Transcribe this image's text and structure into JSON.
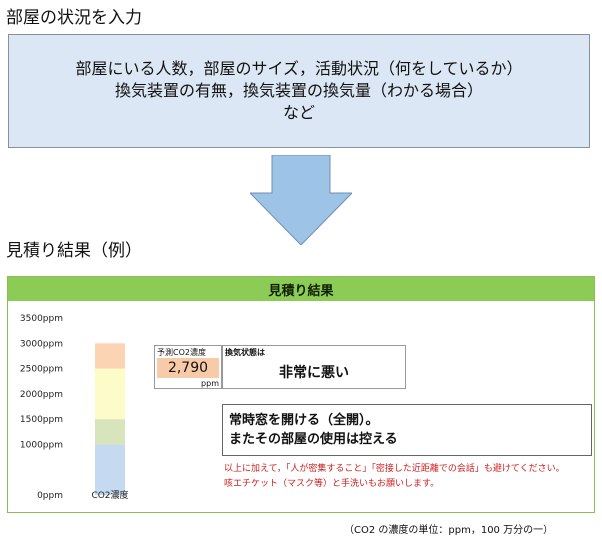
{
  "input_section": {
    "heading": "部屋の状況を入力",
    "lines": [
      "部屋にいる人数，部屋のサイズ，活動状況（何をしているか）",
      "換気装置の有無，換気装置の換気量（わかる場合）",
      "など"
    ]
  },
  "result_section": {
    "heading": "見積り結果（例）",
    "panel_title": "見積り結果",
    "prediction_label": "予測CO2濃度",
    "prediction_value": "2,790",
    "prediction_unit": "ppm",
    "state_label": "換気状態は",
    "state_value": "非常に悪い",
    "advice_lines": [
      "常時窓を開ける（全開）。",
      "またその部屋の使用は控える"
    ],
    "note_lines": [
      "以上に加えて，「人が密集すること」「密接した近距離での会話」も避けてください。",
      "咳エチケット（マスク等）と手洗いもお願いします。"
    ]
  },
  "footer": {
    "unit_note": "（CO2 の濃度の単位：ppm，100 万分の一）"
  },
  "colors": {
    "input_box_bg": "#dbe7f4",
    "arrow_fill": "#9dc3e6",
    "header_green": "#8ccb55",
    "prediction_bg": "#f8cba8",
    "note_red": "#cc1f1f"
  },
  "chart_data": {
    "type": "bar",
    "categories": [
      "CO2濃度"
    ],
    "ylim": [
      0,
      3500
    ],
    "yticks": [
      0,
      1000,
      1500,
      2000,
      2500,
      3000,
      3500
    ],
    "ytick_labels": [
      "0ppm",
      "1000ppm",
      "1500ppm",
      "2000ppm",
      "2500ppm",
      "3000ppm",
      "3500ppm"
    ],
    "bands": [
      {
        "from": 0,
        "to": 1000,
        "color": "#c5d9f1"
      },
      {
        "from": 1000,
        "to": 1500,
        "color": "#d7e4bc"
      },
      {
        "from": 1500,
        "to": 2500,
        "color": "#fdfcc8"
      },
      {
        "from": 2500,
        "to": 3000,
        "color": "#fbd4b4"
      }
    ]
  }
}
